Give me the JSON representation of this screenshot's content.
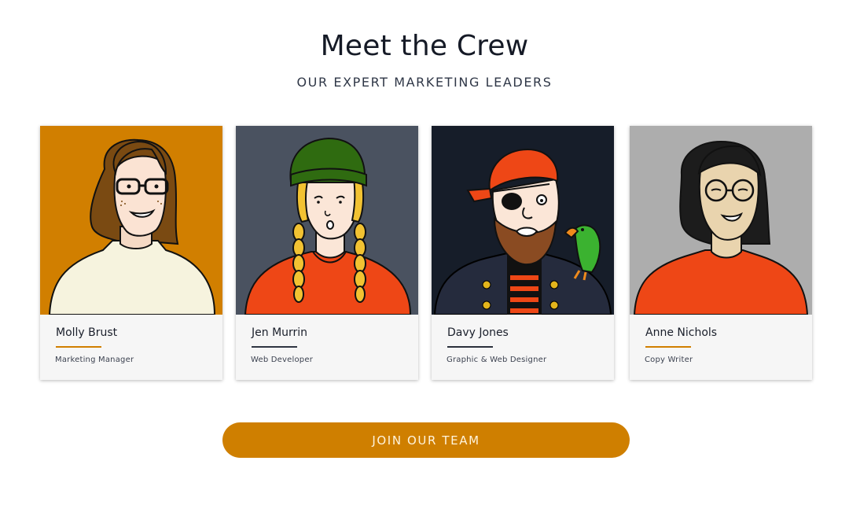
{
  "header": {
    "title": "Meet the Crew",
    "subtitle": "OUR EXPERT MARKETING LEADERS"
  },
  "team": [
    {
      "name": "Molly Brust",
      "role": "Marketing Manager",
      "portrait_bg": "#d17f00",
      "rule_color": "#d17f00",
      "avatar": "woman-glasses-brown-hair-icon"
    },
    {
      "name": "Jen Murrin",
      "role": "Web Developer",
      "portrait_bg": "#4a5260",
      "rule_color": "#2f3542",
      "avatar": "woman-beanie-braids-icon"
    },
    {
      "name": "Davy Jones",
      "role": "Graphic & Web Designer",
      "portrait_bg": "#161d29",
      "rule_color": "#2a303c",
      "avatar": "pirate-with-parrot-icon"
    },
    {
      "name": "Anne Nichols",
      "role": "Copy Writer",
      "portrait_bg": "#adadad",
      "rule_color": "#d17f00",
      "avatar": "woman-round-glasses-black-hair-icon"
    }
  ],
  "cta": {
    "label": "JOIN OUR TEAM"
  },
  "colors": {
    "accent": "#cf7f00",
    "text": "#151a26"
  }
}
